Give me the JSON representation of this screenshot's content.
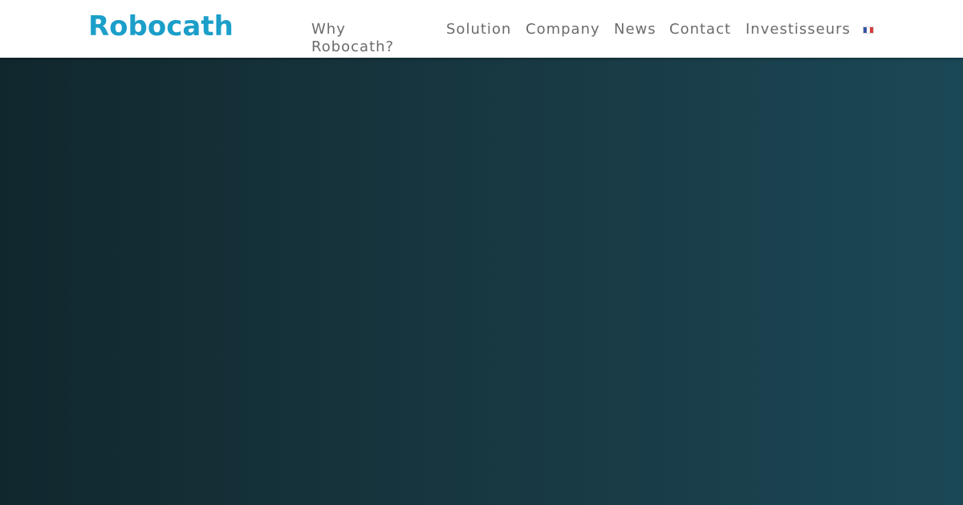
{
  "header": {
    "logo_text": "Robocath",
    "brand_color": "#1b9fc9",
    "nav": [
      {
        "label": "Why Robocath?"
      },
      {
        "label": "Solution"
      },
      {
        "label": "Company"
      },
      {
        "label": "News"
      },
      {
        "label": "Contact"
      },
      {
        "label": "Investisseurs"
      }
    ],
    "language_flag": {
      "icon": "french-flag-icon",
      "colors": [
        "#3855a7",
        "#ffffff",
        "#d63a3a"
      ]
    }
  },
  "hero": {
    "background_colors": [
      "#11272e",
      "#1b4856"
    ]
  }
}
